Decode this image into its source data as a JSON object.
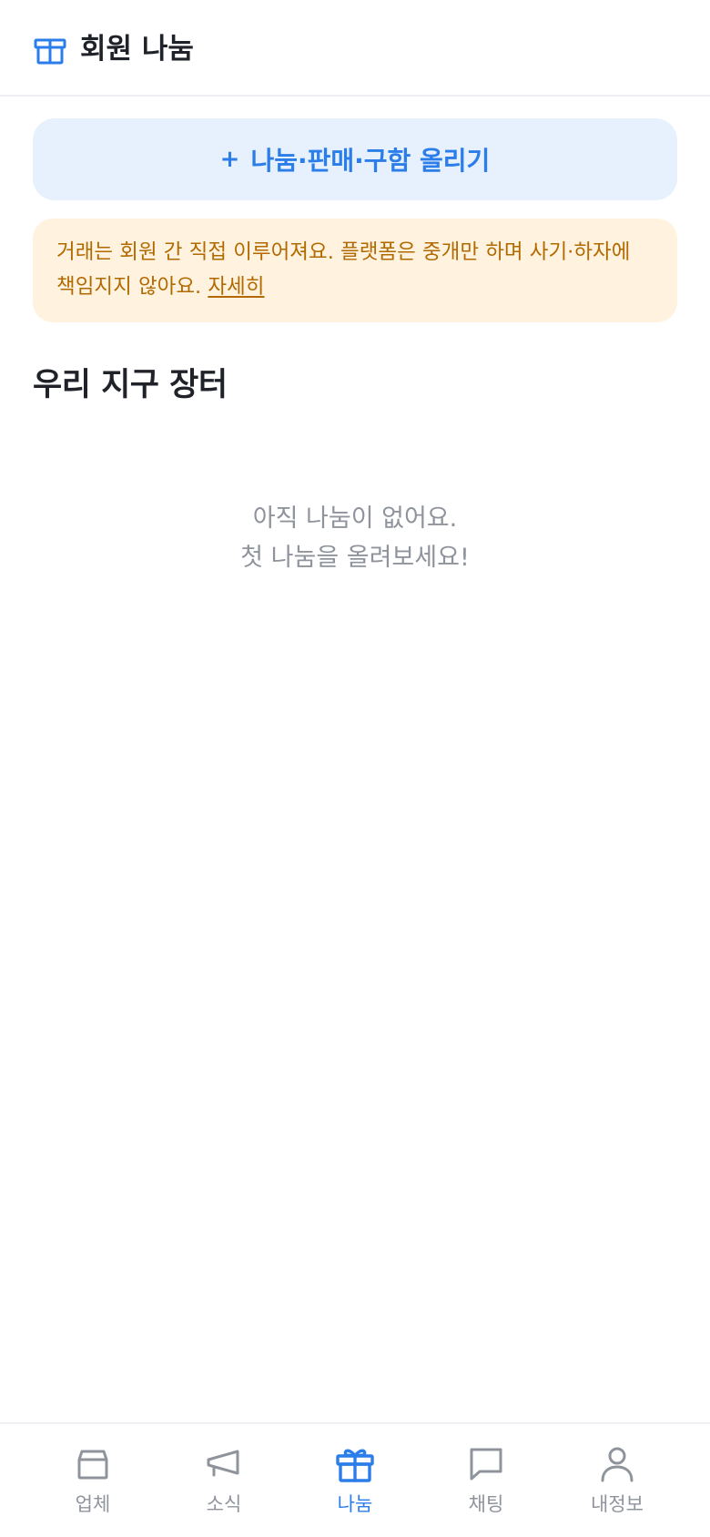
{
  "header": {
    "title": "회원 나눔",
    "icon": "gift-icon"
  },
  "actions": {
    "post_plus": "+",
    "post_label": "나눔·판매·구함 올리기"
  },
  "notice": {
    "text": "거래는 회원 간 직접 이루어져요. 플랫폼은 중개만 하며 사기·하자에 책임지지 않아요. ",
    "link_label": "자세히"
  },
  "section": {
    "title": "우리 지구 장터"
  },
  "empty_state": {
    "line1": "아직 나눔이 없어요.",
    "line2": "첫 나눔을 올려보세요!"
  },
  "bottom_nav": {
    "items": [
      {
        "label": "업체",
        "icon": "store-icon",
        "active": false
      },
      {
        "label": "소식",
        "icon": "megaphone-icon",
        "active": false
      },
      {
        "label": "나눔",
        "icon": "gift-icon",
        "active": true
      },
      {
        "label": "채팅",
        "icon": "chat-bubble-icon",
        "active": false
      },
      {
        "label": "내정보",
        "icon": "user-icon",
        "active": false
      }
    ]
  },
  "colors": {
    "accent": "#2b7de9",
    "accent_bg": "#e6f1fd",
    "notice_text": "#b26a00",
    "notice_bg": "#fff3e0",
    "muted": "#8f949c",
    "text": "#1f2329"
  }
}
